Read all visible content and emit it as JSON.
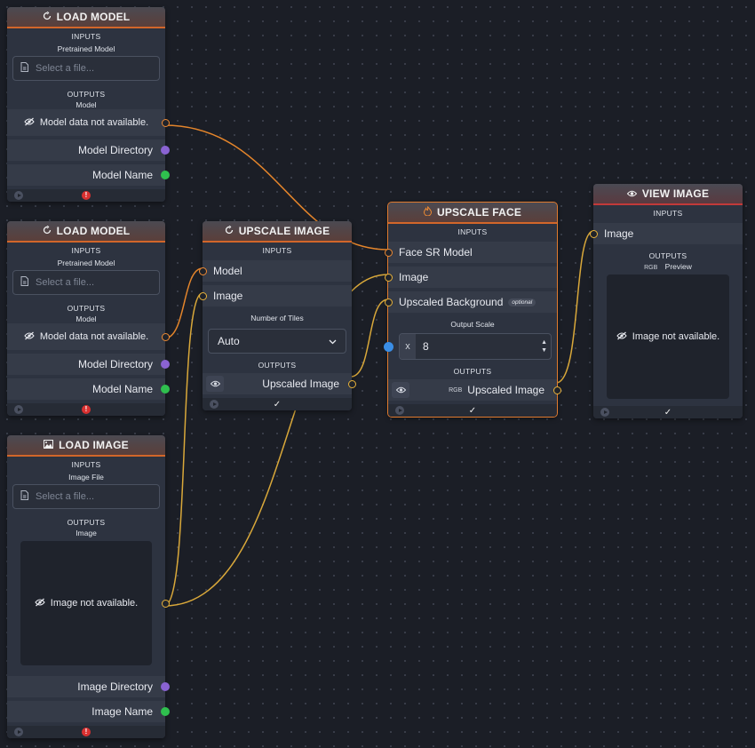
{
  "colors": {
    "background": "#1b1e26",
    "node": "#2d3340",
    "accent_orange": "#e07a2e",
    "wire_orange": "#e4852b",
    "wire_yellow": "#d9a83a",
    "purple": "#8a63d2",
    "green": "#2fbf4e",
    "blue": "#3a8ee6",
    "error": "#d93030"
  },
  "load_model_1": {
    "title": "LOAD MODEL",
    "icon": "refresh-icon",
    "inputs_label": "INPUTS",
    "input_label": "Pretrained Model",
    "file_placeholder": "Select a file...",
    "outputs_label": "OUTPUTS",
    "output_label": "Model",
    "model_status": "Model data not available.",
    "directory": "Model Directory",
    "name": "Model Name"
  },
  "load_model_2": {
    "title": "LOAD MODEL",
    "icon": "refresh-icon",
    "inputs_label": "INPUTS",
    "input_label": "Pretrained Model",
    "file_placeholder": "Select a file...",
    "outputs_label": "OUTPUTS",
    "output_label": "Model",
    "model_status": "Model data not available.",
    "directory": "Model Directory",
    "name": "Model Name"
  },
  "load_image": {
    "title": "LOAD IMAGE",
    "icon": "image-icon",
    "inputs_label": "INPUTS",
    "input_label": "Image File",
    "file_placeholder": "Select a file...",
    "outputs_label": "OUTPUTS",
    "output_label": "Image",
    "image_status": "Image not available.",
    "directory": "Image Directory",
    "name": "Image Name"
  },
  "upscale_image": {
    "title": "UPSCALE IMAGE",
    "icon": "refresh-icon",
    "inputs_label": "INPUTS",
    "input_model": "Model",
    "input_image": "Image",
    "tiles_label": "Number of Tiles",
    "tiles_value": "Auto",
    "outputs_label": "OUTPUTS",
    "output_label": "Upscaled Image"
  },
  "upscale_face": {
    "title": "UPSCALE FACE",
    "icon": "flame-icon",
    "inputs_label": "INPUTS",
    "input_face_model": "Face SR Model",
    "input_image": "Image",
    "input_background": "Upscaled Background",
    "optional_tag": "optional",
    "scale_label": "Output Scale",
    "scale_prefix": "x",
    "scale_value": "8",
    "outputs_label": "OUTPUTS",
    "output_type": "RGB",
    "output_label": "Upscaled Image"
  },
  "view_image": {
    "title": "VIEW IMAGE",
    "icon": "eye-icon",
    "inputs_label": "INPUTS",
    "input_image": "Image",
    "outputs_label": "OUTPUTS",
    "preview_type": "RGB",
    "preview_label": "Preview",
    "image_status": "Image not available."
  },
  "footer": {
    "error_glyph": "!",
    "check_glyph": "✓"
  }
}
